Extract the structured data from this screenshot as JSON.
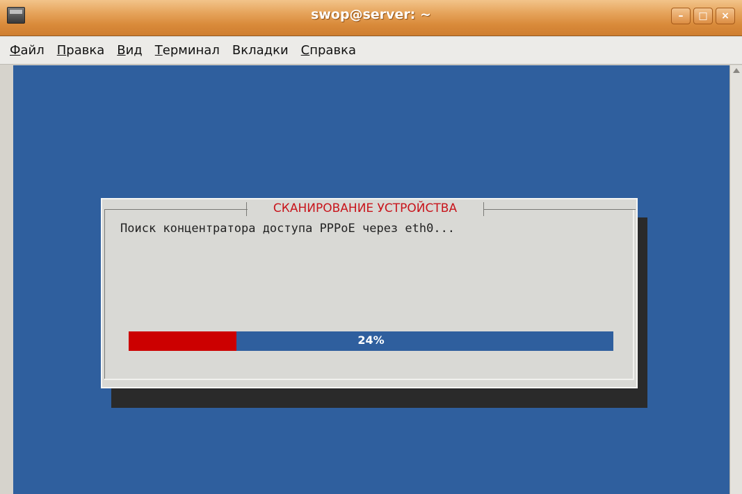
{
  "window": {
    "title": "swop@server: ~",
    "buttons": {
      "minimize": "–",
      "maximize": "□",
      "close": "×"
    }
  },
  "menu": {
    "items": [
      {
        "accel": "Ф",
        "rest": "айл"
      },
      {
        "accel": "П",
        "rest": "равка"
      },
      {
        "accel": "В",
        "rest": "ид"
      },
      {
        "accel": "Т",
        "rest": "ерминал"
      },
      {
        "pre": "Вкла",
        "accel": "д",
        "rest": "ки"
      },
      {
        "accel": "С",
        "rest": "правка"
      }
    ]
  },
  "dialog": {
    "title": "СКАНИРОВАНИЕ УСТРОЙСТВА",
    "message": "Поиск концентратора доступа PPPoE через eth0...",
    "progress": {
      "value": 0.24,
      "label": "24%"
    }
  },
  "colors": {
    "terminal_bg": "#2f5f9e",
    "progress_fill": "#cc0000",
    "title_text": "#c8141b"
  }
}
